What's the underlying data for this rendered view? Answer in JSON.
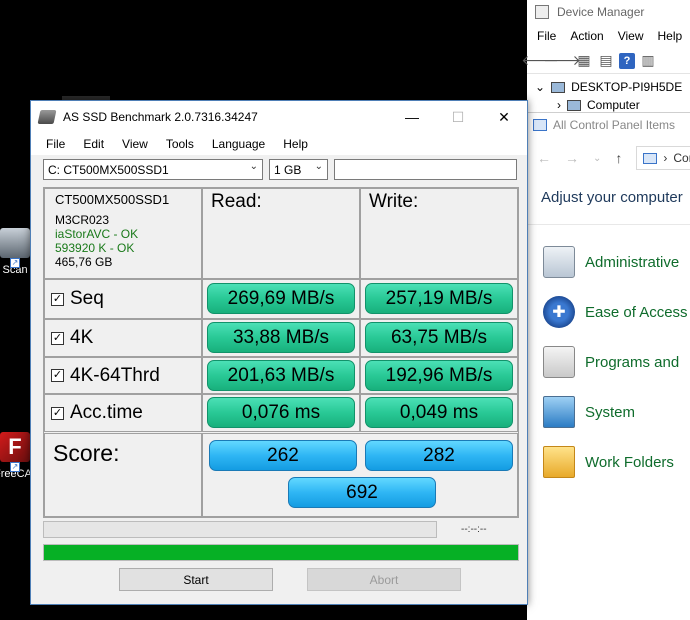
{
  "desktop": {
    "icons": [
      {
        "label": "J Scan"
      },
      {
        "label": "FreeCA",
        "glyph": "F"
      }
    ]
  },
  "device_manager": {
    "title": "Device Manager",
    "menu": [
      "File",
      "Action",
      "View",
      "Help"
    ],
    "tree": {
      "root": "DESKTOP-PI9H5DE",
      "child": "Computer"
    }
  },
  "control_panel": {
    "title": "All Control Panel Items",
    "address": "Con",
    "heading": "Adjust your computer",
    "items": [
      {
        "label": "Administrative",
        "icon": "admin-tools-icon"
      },
      {
        "label": "Ease of Access",
        "icon": "ease-of-access-icon"
      },
      {
        "label": "Programs and",
        "icon": "programs-icon"
      },
      {
        "label": "System",
        "icon": "system-icon"
      },
      {
        "label": "Work Folders",
        "icon": "work-folders-icon"
      }
    ]
  },
  "app": {
    "title": "AS SSD Benchmark 2.0.7316.34247",
    "menu": [
      "File",
      "Edit",
      "View",
      "Tools",
      "Language",
      "Help"
    ],
    "drive_select": "C: CT500MX500SSD1",
    "size_select": "1 GB",
    "info": {
      "model": "CT500MX500SSD1",
      "firmware": "M3CR023",
      "driver": "iaStorAVC - OK",
      "alignment": "593920 K - OK",
      "capacity": "465,76 GB"
    },
    "columns": {
      "read": "Read:",
      "write": "Write:"
    },
    "tests": [
      {
        "name": "Seq",
        "read": "269,69 MB/s",
        "write": "257,19 MB/s",
        "checked": true
      },
      {
        "name": "4K",
        "read": "33,88 MB/s",
        "write": "63,75 MB/s",
        "checked": true
      },
      {
        "name": "4K-64Thrd",
        "read": "201,63 MB/s",
        "write": "192,96 MB/s",
        "checked": true
      },
      {
        "name": "Acc.time",
        "read": "0,076 ms",
        "write": "0,049 ms",
        "checked": true
      }
    ],
    "score": {
      "label": "Score:",
      "read": "262",
      "write": "282",
      "total": "692"
    },
    "time_display": "--:--:--",
    "progress_fraction": 1.0,
    "buttons": {
      "start": "Start",
      "abort": "Abort"
    },
    "colors": {
      "result": "#29c996",
      "score": "#2fb6f4",
      "progress": "#06b025"
    }
  }
}
